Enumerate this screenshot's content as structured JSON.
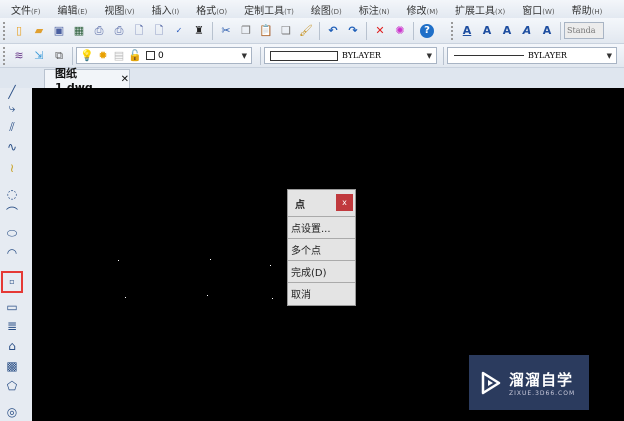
{
  "menu": [
    {
      "label": "文件",
      "key": "(F)"
    },
    {
      "label": "编辑",
      "key": "(E)"
    },
    {
      "label": "视图",
      "key": "(V)"
    },
    {
      "label": "插入",
      "key": "(I)"
    },
    {
      "label": "格式",
      "key": "(O)"
    },
    {
      "label": "定制工具",
      "key": "(T)"
    },
    {
      "label": "绘图",
      "key": "(D)"
    },
    {
      "label": "标注",
      "key": "(N)"
    },
    {
      "label": "修改",
      "key": "(M)"
    },
    {
      "label": "扩展工具",
      "key": "(X)"
    },
    {
      "label": "窗口",
      "key": "(W)"
    },
    {
      "label": "帮助",
      "key": "(H)"
    }
  ],
  "toolbar": {
    "text_style": "Standa",
    "layer_value": "0",
    "color_value": "BYLAYER",
    "linetype_value": "BYLAYER"
  },
  "tab": {
    "title": "图纸1.dwg",
    "close": "✕"
  },
  "popup": {
    "title": "点",
    "close": "x",
    "items": [
      "点设置...",
      "多个点",
      "完成(D)",
      "取消"
    ]
  },
  "watermark": {
    "name": "溜溜自学",
    "url": "ZIXUE.3D66.COM"
  },
  "colors": {
    "canvas": "#000000",
    "popup_close": "#c0393d",
    "highlight": "#e53935"
  }
}
